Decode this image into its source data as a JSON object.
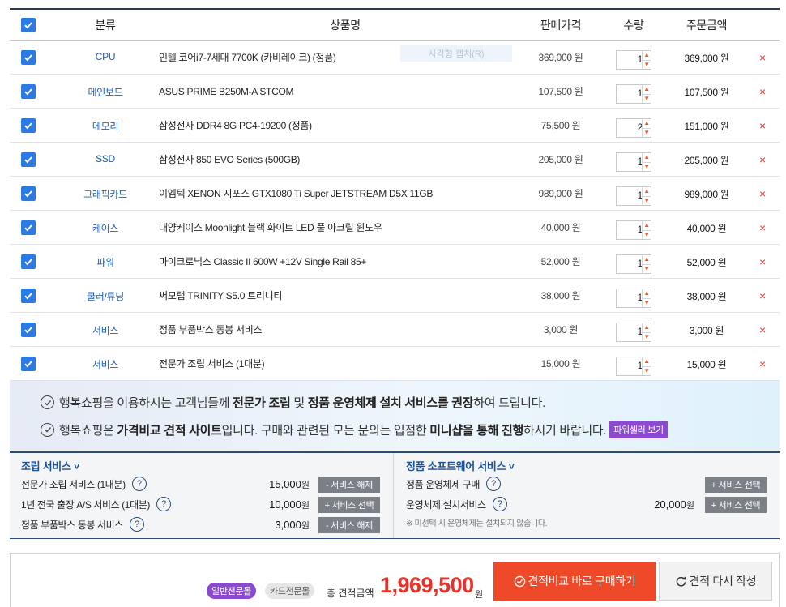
{
  "header": {
    "category": "분류",
    "name": "상품명",
    "price": "판매가격",
    "qty": "수량",
    "total": "주문금액"
  },
  "overlay_label": "사각형 캡처(R)",
  "items": [
    {
      "category": "CPU",
      "name": "인텔 코어i7-7세대 7700K (카비레이크) (정품)",
      "price": "369,000 원",
      "qty": "1",
      "total": "369,000 원",
      "checked": true
    },
    {
      "category": "메인보드",
      "name": "ASUS PRIME B250M-A STCOM",
      "price": "107,500 원",
      "qty": "1",
      "total": "107,500 원",
      "checked": true
    },
    {
      "category": "메모리",
      "name": "삼성전자 DDR4 8G PC4-19200 (정품)",
      "price": "75,500 원",
      "qty": "2",
      "total": "151,000 원",
      "checked": true
    },
    {
      "category": "SSD",
      "name": "삼성전자 850 EVO Series (500GB)",
      "price": "205,000 원",
      "qty": "1",
      "total": "205,000 원",
      "checked": true
    },
    {
      "category": "그래픽카드",
      "name": "이엠텍 XENON 지포스 GTX1080 Ti Super JETSTREAM D5X 11GB",
      "price": "989,000 원",
      "qty": "1",
      "total": "989,000 원",
      "checked": true
    },
    {
      "category": "케이스",
      "name": "대양케이스 Moonlight 블랙 화이트 LED 풀 아크릴 윈도우",
      "price": "40,000 원",
      "qty": "1",
      "total": "40,000 원",
      "checked": true
    },
    {
      "category": "파워",
      "name": "마이크로닉스 Classic II 600W +12V Single Rail 85+",
      "price": "52,000 원",
      "qty": "1",
      "total": "52,000 원",
      "checked": true
    },
    {
      "category": "쿨러/튜닝",
      "name": "써모랩 TRINITY S5.0 트리니티",
      "price": "38,000 원",
      "qty": "1",
      "total": "38,000 원",
      "checked": true
    },
    {
      "category": "서비스",
      "name": "정품 부품박스 동봉 서비스",
      "price": "3,000 원",
      "qty": "1",
      "total": "3,000 원",
      "checked": true
    },
    {
      "category": "서비스",
      "name": "전문가 조립 서비스 (1대분)",
      "price": "15,000 원",
      "qty": "1",
      "total": "15,000 원",
      "checked": true
    }
  ],
  "delete_symbol": "×",
  "notice": {
    "line1": [
      {
        "t": "행복쇼핑을 이용하시는 고객님들께 ",
        "b": false
      },
      {
        "t": "전문가 조립",
        "b": true
      },
      {
        "t": " 및 ",
        "b": false
      },
      {
        "t": "정품 운영체제 설치 서비스를 권장",
        "b": true
      },
      {
        "t": "하여 드립니다.",
        "b": false
      }
    ],
    "line2": [
      {
        "t": "행복쇼핑은 ",
        "b": false
      },
      {
        "t": "가격비교 견적 사이트",
        "b": true
      },
      {
        "t": "입니다. 구매와 관련된 모든 문의는 입점한 ",
        "b": false
      },
      {
        "t": "미니샵을 통해 진행",
        "b": true
      },
      {
        "t": "하시기 바랍니다.",
        "b": false
      }
    ],
    "power_button": "파워셀러 보기"
  },
  "assembly": {
    "title": "조립 서비스 ˅",
    "rows": [
      {
        "label": "전문가 조립 서비스 (1대분)",
        "price": "15,000",
        "unit": "원",
        "button": "- 서비스 해제"
      },
      {
        "label": "1년 전국 출장 A/S 서비스 (1대분)",
        "price": "10,000",
        "unit": "원",
        "button": "+ 서비스 선택"
      },
      {
        "label": "정품 부품박스 동봉 서비스",
        "price": "3,000",
        "unit": "원",
        "button": "- 서비스 해제"
      }
    ]
  },
  "software": {
    "title": "정품 소프트웨어 서비스 ˅",
    "rows": [
      {
        "label": "정품 운영체제 구매",
        "price": "",
        "unit": "",
        "button": "+ 서비스 선택"
      },
      {
        "label": "운영체제 설치서비스",
        "price": "20,000",
        "unit": "원",
        "button": "+ 서비스 선택"
      }
    ],
    "note": "※ 미선택 시 운영체제는 설치되지 않습니다."
  },
  "bottom": {
    "tag_active": "일반전문몰",
    "tag_inactive": "카드전문몰",
    "total_label": "총 견적금액",
    "total_amount": "1,969,500",
    "total_unit": "원",
    "buy_button": "견적비교 바로 구매하기",
    "redo_button": "견적 다시 작성"
  },
  "colors": {
    "checkbox": "#2c7be5",
    "accent_red": "#ee4a2a",
    "accent_purple": "#8a4bd0",
    "category_blue": "#1a5fb4"
  }
}
